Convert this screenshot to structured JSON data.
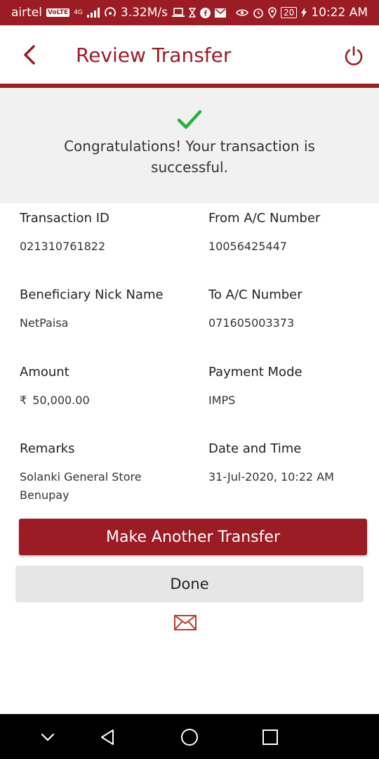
{
  "status_bar": {
    "carrier": "airtel",
    "volte": "VoLTE",
    "network": "4G",
    "speed": "3.32M/s",
    "battery": "20",
    "time": "10:22 AM"
  },
  "header": {
    "title": "Review Transfer",
    "back_icon": "chevron-left-icon",
    "power_icon": "power-icon"
  },
  "success": {
    "icon": "checkmark-icon",
    "message": "Congratulations! Your transaction is successful."
  },
  "details": {
    "transaction_id": {
      "label": "Transaction ID",
      "value": "021310761822"
    },
    "from_account": {
      "label": "From A/C Number",
      "value": "10056425447"
    },
    "beneficiary": {
      "label": "Beneficiary Nick Name",
      "value": "NetPaisa"
    },
    "to_account": {
      "label": "To A/C Number",
      "value": "071605003373"
    },
    "amount": {
      "label": "Amount",
      "currency": "₹",
      "value": "50,000.00"
    },
    "payment_mode": {
      "label": "Payment Mode",
      "value": "IMPS"
    },
    "remarks": {
      "label": "Remarks",
      "value": "Solanki General Store Benupay"
    },
    "date_time": {
      "label": "Date and Time",
      "value": "31-Jul-2020, 10:22 AM"
    }
  },
  "actions": {
    "make_another": "Make Another Transfer",
    "done": "Done",
    "mail_icon": "mail-icon"
  },
  "colors": {
    "brand": "#9b1c24",
    "success": "#22b33a",
    "panel": "#f1f1f1",
    "secondary_button": "#e6e6e6"
  }
}
